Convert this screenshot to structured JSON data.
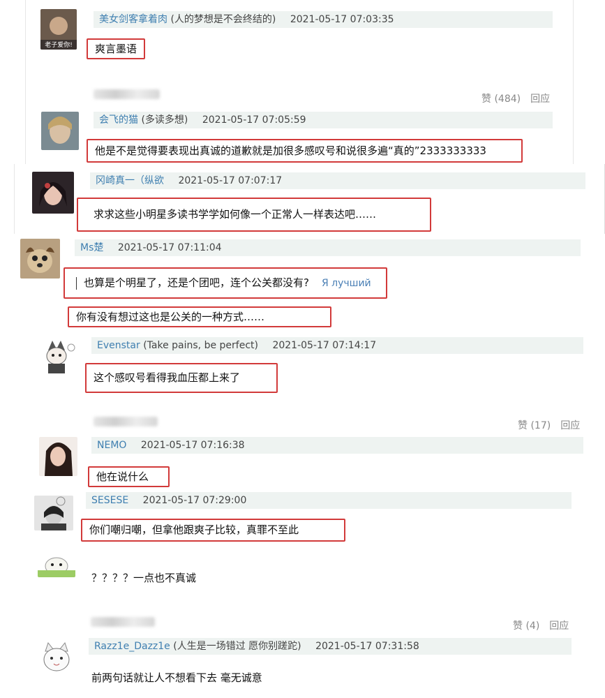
{
  "comments": [
    {
      "user": "美女剑客拿着肉",
      "sig": "(人的梦想是不会终结的)",
      "time": "2021-05-17 07:03:35",
      "text": "爽言墨语",
      "avatar_caption": "老子爱你!"
    },
    {
      "user": "会飞的猫",
      "sig": "(多读多想)",
      "time": "2021-05-17 07:05:59",
      "text": "他是不是觉得要表现出真诚的道歉就是加很多感叹号和说很多遍“真的”2333333333"
    },
    {
      "user": "冈崎真一（纵欲",
      "sig": "",
      "time": "2021-05-17 07:07:17",
      "text": "求求这些小明星多读书学学如何像一个正常人一样表达吧……"
    },
    {
      "user": "Ms楚",
      "sig": "",
      "time": "2021-05-17 07:11:04",
      "text": "也算是个明星了，还是个团吧，连个公关都没有?",
      "translate": "Я лучший"
    },
    {
      "text": "你有没有想过这也是公关的一种方式……"
    },
    {
      "user": "Evenstar",
      "sig": "(Take pains, be perfect)",
      "time": "2021-05-17 07:14:17",
      "text": "这个感叹号看得我血压都上来了"
    },
    {
      "user": "NEMO",
      "sig": "",
      "time": "2021-05-17 07:16:38",
      "text": "他在说什么"
    },
    {
      "user": "SESESE",
      "sig": "",
      "time": "2021-05-17 07:29:00",
      "text": "你们嘲归嘲，但拿他跟爽子比较，真罪不至此"
    },
    {
      "text": "？？？？一点也不真诚"
    },
    {
      "user": "Razz1e_Dazz1e",
      "sig": "(人生是一场错过 愿你别蹉跎)",
      "time": "2021-05-17 07:31:58",
      "text": "前两句话就让人不想看下去 毫无诚意"
    }
  ],
  "threads": [
    {
      "likes": "赞 (484)",
      "reply": "回应"
    },
    {
      "likes": "赞 (17)",
      "reply": "回应"
    },
    {
      "likes": "赞 (4)",
      "reply": "回应"
    }
  ]
}
